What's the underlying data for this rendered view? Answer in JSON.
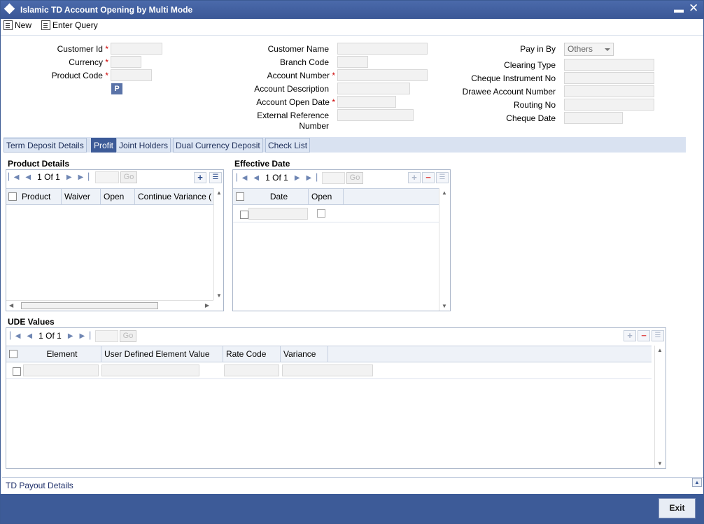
{
  "window": {
    "title": "Islamic TD Account Opening by Multi Mode",
    "minimize": "▬",
    "close": "✕"
  },
  "toolbar": {
    "new_label": "New",
    "enter_query_label": "Enter Query"
  },
  "form": {
    "customer_id": {
      "label": "Customer Id",
      "required": "*",
      "value": ""
    },
    "currency": {
      "label": "Currency",
      "required": "*",
      "value": ""
    },
    "product_code": {
      "label": "Product Code",
      "required": "*",
      "value": ""
    },
    "p_button": "P",
    "customer_name": {
      "label": "Customer Name",
      "value": ""
    },
    "branch_code": {
      "label": "Branch Code",
      "value": ""
    },
    "account_number": {
      "label": "Account Number",
      "required": "*",
      "value": ""
    },
    "account_description": {
      "label": "Account Description",
      "value": ""
    },
    "account_open_date": {
      "label": "Account Open Date",
      "required": "*",
      "value": ""
    },
    "external_reference": {
      "label_line1": "External Reference",
      "label_line2": "Number",
      "value": ""
    },
    "pay_in_by": {
      "label": "Pay in By",
      "value": "Others"
    },
    "clearing_type": {
      "label": "Clearing Type",
      "value": ""
    },
    "cheque_instrument_no": {
      "label": "Cheque Instrument No",
      "value": ""
    },
    "drawee_account_number": {
      "label": "Drawee Account Number",
      "value": ""
    },
    "routing_no": {
      "label": "Routing No",
      "value": ""
    },
    "cheque_date": {
      "label": "Cheque Date",
      "value": ""
    }
  },
  "tabs": [
    {
      "label": "Term Deposit Details",
      "active": false
    },
    {
      "label": "Profit",
      "active": true
    },
    {
      "label": "Joint Holders",
      "active": false
    },
    {
      "label": "Dual Currency Deposit",
      "active": false
    },
    {
      "label": "Check List",
      "active": false
    }
  ],
  "product_details": {
    "title": "Product Details",
    "pager": {
      "current": "1",
      "of_label": "Of",
      "total": "1",
      "go_label": "Go"
    },
    "columns": [
      "Product",
      "Waiver",
      "Open",
      "Continue Variance (",
      ""
    ]
  },
  "effective_date": {
    "title": "Effective Date",
    "pager": {
      "current": "1",
      "of_label": "Of",
      "total": "1",
      "go_label": "Go"
    },
    "columns": [
      "Date",
      "Open"
    ]
  },
  "ude_values": {
    "title": "UDE Values",
    "pager": {
      "current": "1",
      "of_label": "Of",
      "total": "1",
      "go_label": "Go"
    },
    "columns": [
      "Element",
      "User Defined Element Value",
      "Rate Code",
      "Variance"
    ]
  },
  "footer": {
    "td_payout_label": "TD Payout Details",
    "exit_label": "Exit"
  },
  "colors": {
    "title_bar": "#3d5b98",
    "active_tab": "#3d5b98",
    "required": "#cc0000"
  }
}
